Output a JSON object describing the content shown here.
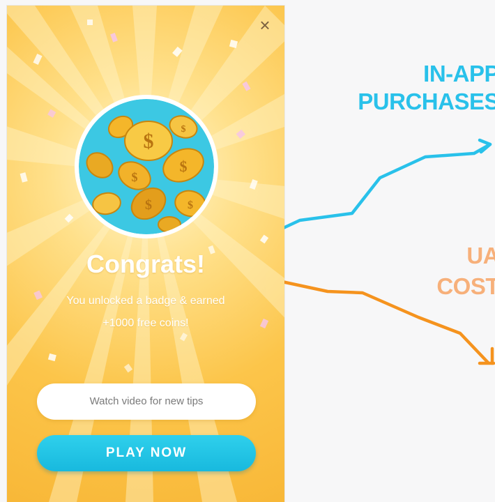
{
  "popup": {
    "close_symbol": "×",
    "headline": "Congrats!",
    "message_line1": "You unlocked a badge & earned",
    "message_line2": "+1000 free coins!",
    "watch_button_label": "Watch video for new tips",
    "play_button_label": "PLAY NOW",
    "illustration": "gold-coins-illustration"
  },
  "graph": {
    "label_top_line1": "IN-APP",
    "label_top_line2": "PURCHASES",
    "label_bottom_line1": "UA",
    "label_bottom_line2": "COST",
    "top_line_color": "#29c1ea",
    "bottom_line_color": "#f5931e"
  },
  "colors": {
    "popup_background": "#fcc54a",
    "play_button": "#1fc3e6",
    "medallion_background": "#3cc8e3"
  }
}
